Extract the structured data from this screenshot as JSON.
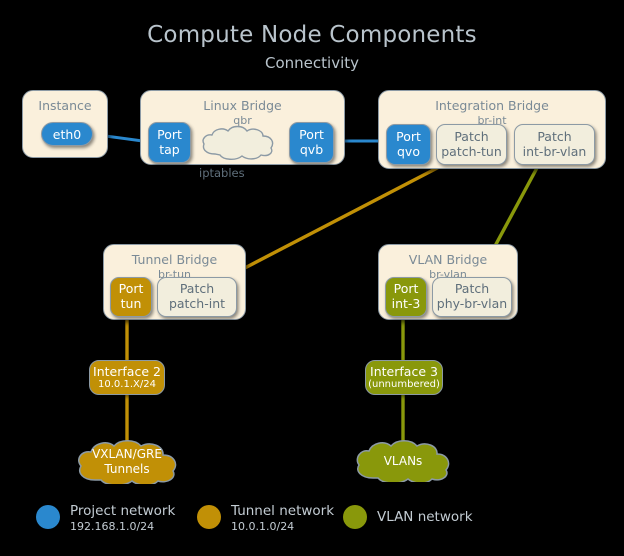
{
  "header": {
    "title": "Compute Node Components",
    "subtitle": "Connectivity"
  },
  "colors": {
    "background": "#000000",
    "project_network": "#2a88ce",
    "tunnel_network": "#c19006",
    "vlan_network": "#89980b",
    "box_fill": "#faf0dc",
    "box_border": "#8c9aa5",
    "title_text": "#b9c4cc"
  },
  "boxes": {
    "instance": {
      "title": "Instance",
      "subtitle": "",
      "nodes": {
        "eth0": "eth0"
      }
    },
    "linux_bridge": {
      "title": "Linux Bridge",
      "subtitle": "qbr",
      "nodes": {
        "port_tap_l1": "Port",
        "port_tap_l2": "tap",
        "iptables": "iptables",
        "port_qvb_l1": "Port",
        "port_qvb_l2": "qvb"
      }
    },
    "integration_bridge": {
      "title": "Integration Bridge",
      "subtitle": "br-int",
      "nodes": {
        "port_qvo_l1": "Port",
        "port_qvo_l2": "qvo",
        "patch_tun_l1": "Patch",
        "patch_tun_l2": "patch-tun",
        "int_br_vlan_l1": "Patch",
        "int_br_vlan_l2": "int-br-vlan"
      }
    },
    "tunnel_bridge": {
      "title": "Tunnel Bridge",
      "subtitle": "br-tun",
      "nodes": {
        "port_tun_l1": "Port",
        "port_tun_l2": "tun",
        "patch_int_l1": "Patch",
        "patch_int_l2": "patch-int"
      }
    },
    "vlan_bridge": {
      "title": "VLAN Bridge",
      "subtitle": "br-vlan",
      "nodes": {
        "port_int3_l1": "Port",
        "port_int3_l2": "int-3",
        "phy_br_vlan_l1": "Patch",
        "phy_br_vlan_l2": "phy-br-vlan"
      }
    }
  },
  "interfaces": {
    "interface2": {
      "name": "Interface 2",
      "sub": "10.0.1.X/24"
    },
    "interface3": {
      "name": "Interface 3",
      "sub": "(unnumbered)"
    }
  },
  "clouds": {
    "vxlan": {
      "line1": "VXLAN/GRE",
      "line2": "Tunnels"
    },
    "vlans": {
      "line1": "VLANs",
      "line2": ""
    }
  },
  "legend": [
    {
      "name": "Project network",
      "sub": "192.168.1.0/24",
      "color": "#2a88ce"
    },
    {
      "name": "Tunnel network",
      "sub": "10.0.1.0/24",
      "color": "#c19006"
    },
    {
      "name": "VLAN network",
      "sub": "",
      "color": "#89980b"
    }
  ]
}
